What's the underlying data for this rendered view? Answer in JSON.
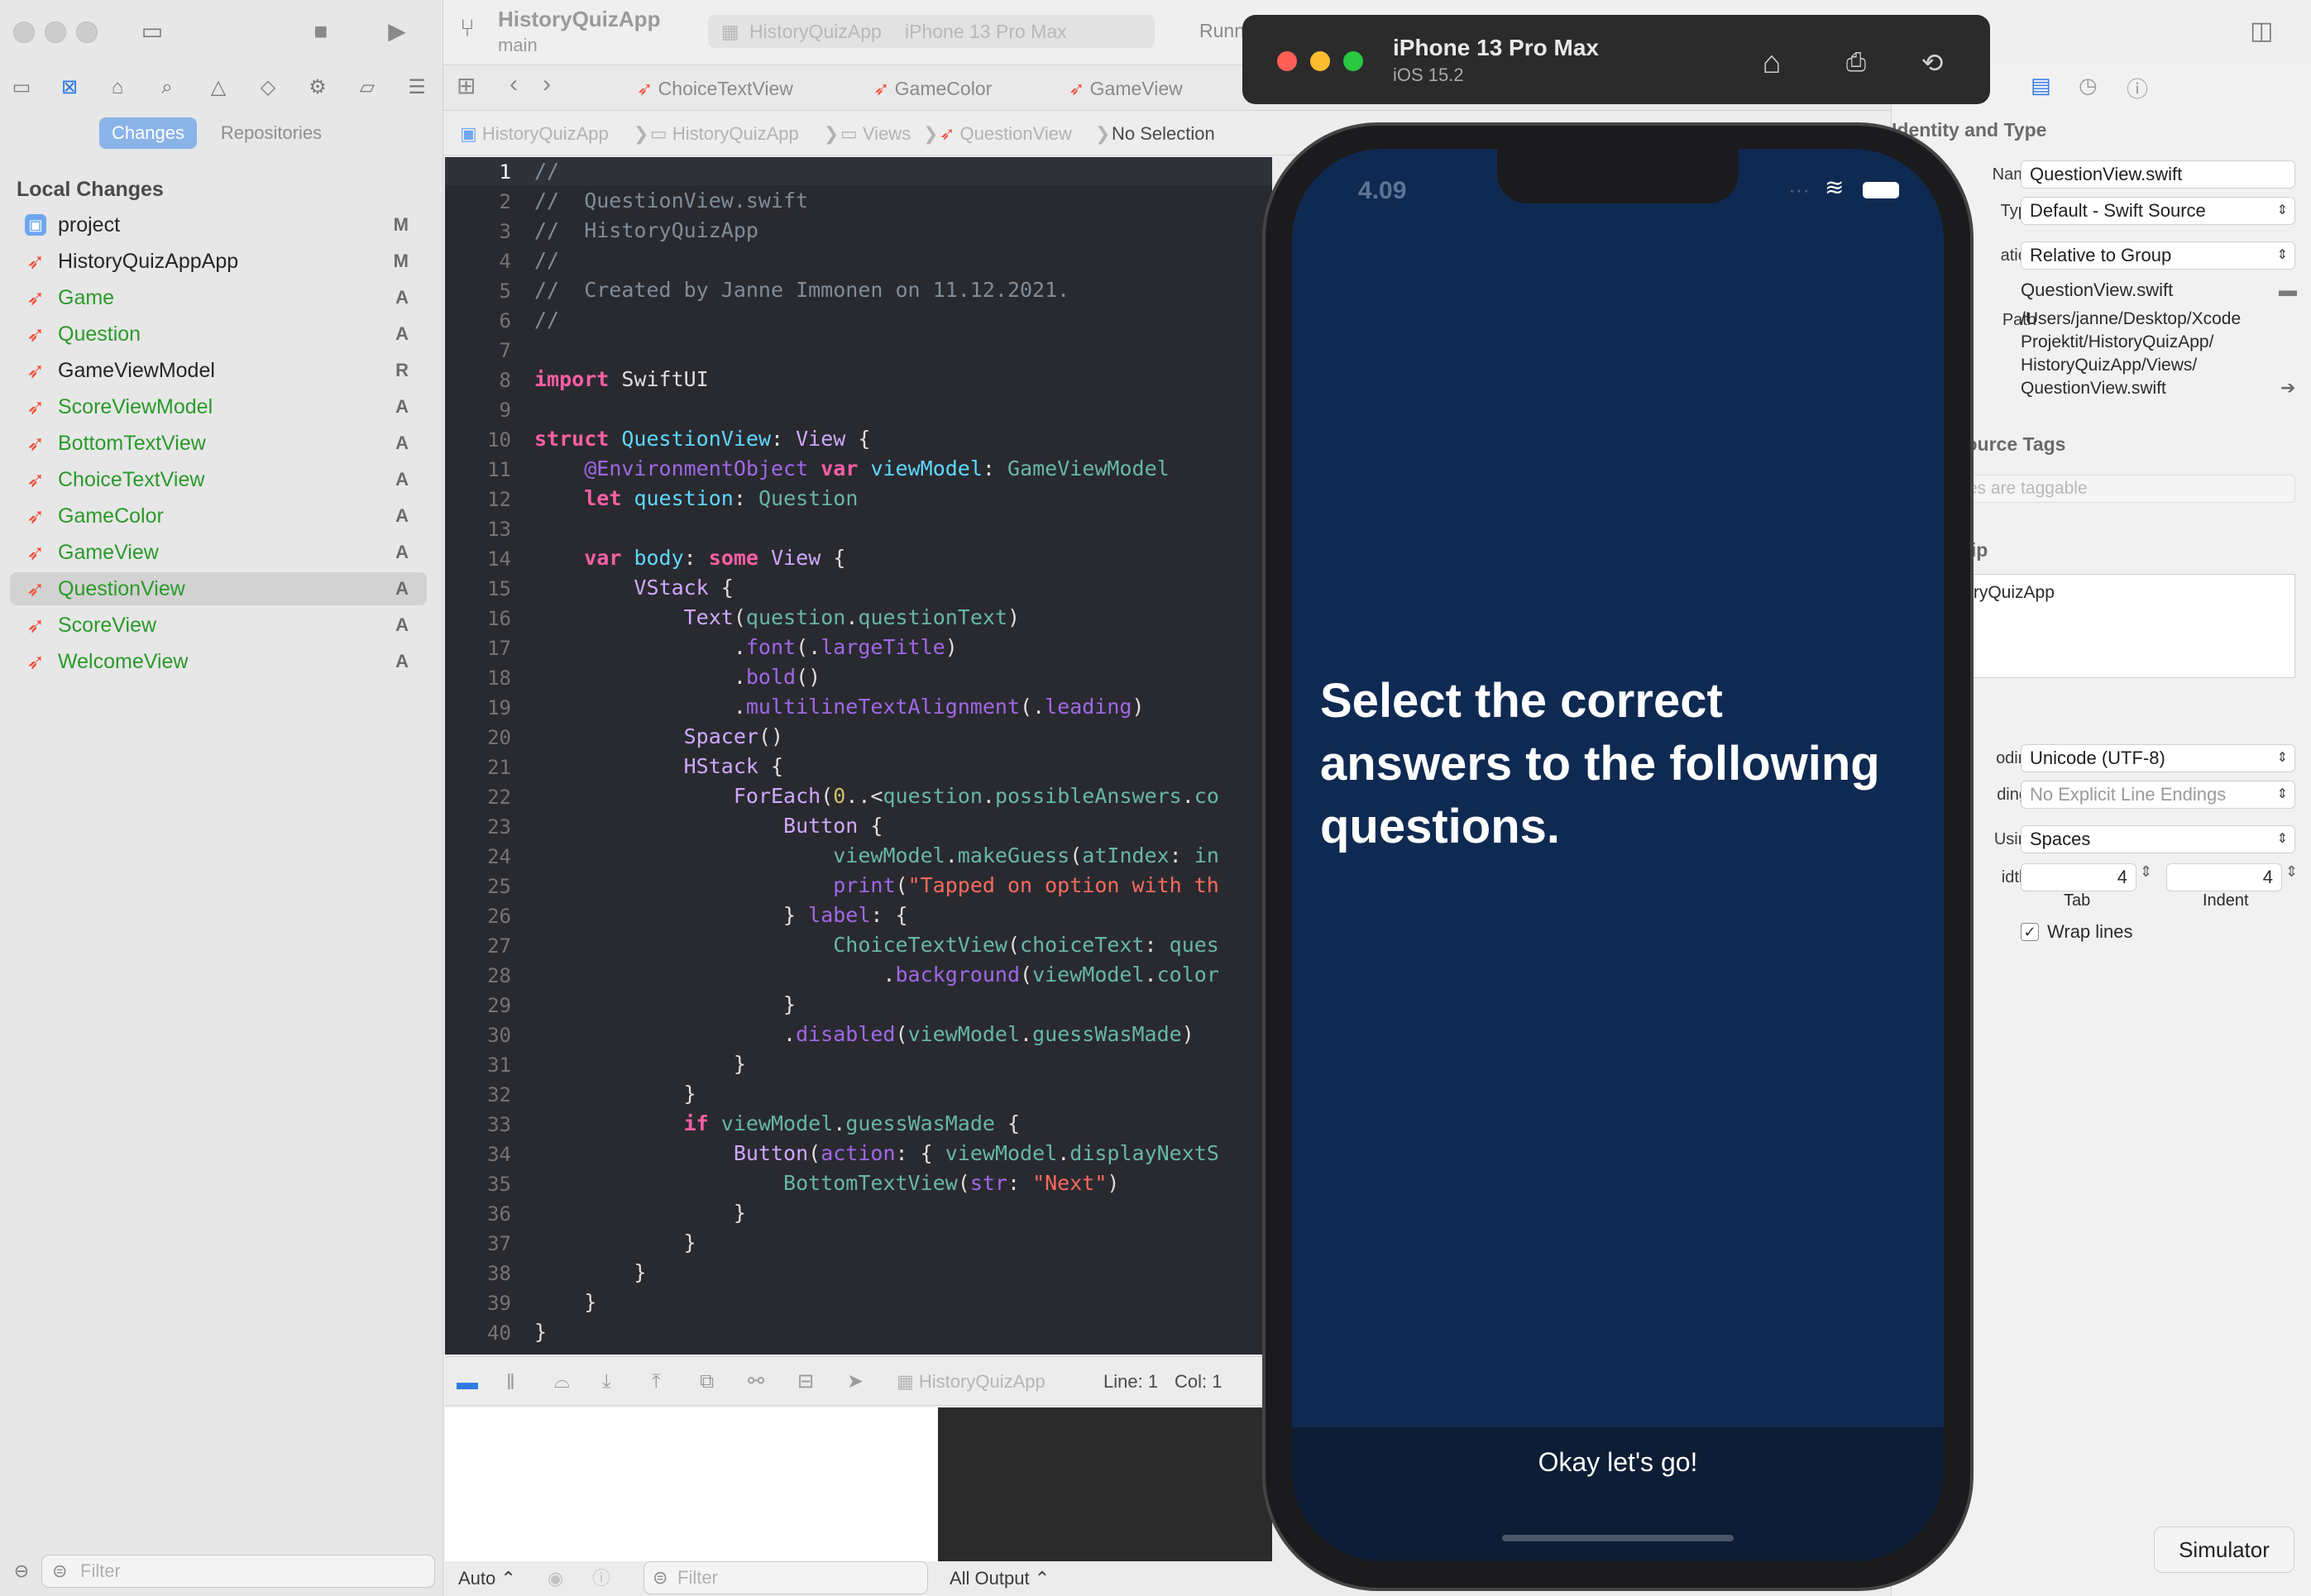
{
  "toolbar": {
    "project_name": "HistoryQuizApp",
    "branch": "main",
    "scheme": "HistoryQuizApp",
    "destination": "iPhone 13 Pro Max",
    "status": "Runn"
  },
  "navigator": {
    "segments": [
      "Changes",
      "Repositories"
    ],
    "section_title": "Local Changes",
    "files": [
      {
        "name": "project",
        "status": "M"
      },
      {
        "name": "HistoryQuizAppApp",
        "status": "M"
      },
      {
        "name": "Game",
        "status": "A"
      },
      {
        "name": "Question",
        "status": "A"
      },
      {
        "name": "GameViewModel",
        "status": "R"
      },
      {
        "name": "ScoreViewModel",
        "status": "A"
      },
      {
        "name": "BottomTextView",
        "status": "A"
      },
      {
        "name": "ChoiceTextView",
        "status": "A"
      },
      {
        "name": "GameColor",
        "status": "A"
      },
      {
        "name": "GameView",
        "status": "A"
      },
      {
        "name": "QuestionView",
        "status": "A"
      },
      {
        "name": "ScoreView",
        "status": "A"
      },
      {
        "name": "WelcomeView",
        "status": "A"
      }
    ],
    "filter_placeholder": "Filter"
  },
  "tabs": [
    "ChoiceTextView",
    "GameColor",
    "GameView"
  ],
  "jumpbar": [
    "HistoryQuizApp",
    "HistoryQuizApp",
    "Views",
    "QuestionView",
    "No Selection"
  ],
  "editor": {
    "line_numbers": [
      "1",
      "2",
      "3",
      "4",
      "5",
      "6",
      "7",
      "8",
      "9",
      "10",
      "11",
      "12",
      "13",
      "14",
      "15",
      "16",
      "17",
      "18",
      "19",
      "20",
      "21",
      "22",
      "23",
      "24",
      "25",
      "26",
      "27",
      "28",
      "29",
      "30",
      "31",
      "32",
      "33",
      "34",
      "35",
      "36",
      "37",
      "38",
      "39",
      "40"
    ]
  },
  "debugbar": {
    "scheme": "HistoryQuizApp",
    "line_label": "Line: 1",
    "col_label": "Col: 1"
  },
  "bottombar": {
    "auto": "Auto",
    "filter": "Filter",
    "output": "All Output"
  },
  "inspector": {
    "identity_title": "Identity and Type",
    "name_label": "Name",
    "name_value": "QuestionView.swift",
    "type_label": "Type",
    "type_value": "Default - Swift Source",
    "location_label": "ation",
    "location_value": "Relative to Group",
    "file_name": "QuestionView.swift",
    "path_label": "Path",
    "path_value": "/Users/janne/Desktop/Xcode Projektit/HistoryQuizApp/ HistoryQuizApp/Views/ QuestionView.swift",
    "tags_title": "and Resource Tags",
    "tags_placeholder": "ources are taggable",
    "membership_title": "embership",
    "membership_target": "HistoryQuizApp",
    "settings_title": "tings",
    "encoding_label": "oding",
    "encoding_value": "Unicode (UTF-8)",
    "endings_label": "dings",
    "endings_value": "No Explicit Line Endings",
    "using_label": "Using",
    "using_value": "Spaces",
    "widths_label": "idths",
    "tab_value": "4",
    "indent_value": "4",
    "tab_caption": "Tab",
    "indent_caption": "Indent",
    "wrap_label": "Wrap lines"
  },
  "simulator": {
    "device": "iPhone 13 Pro Max",
    "os": "iOS 15.2",
    "time": "4.09",
    "headline": "Select the correct answers to the following questions.",
    "button": "Okay let's go!",
    "tooltip": "Simulator"
  },
  "colors": {
    "screen_bg": "#0f2a52",
    "editor_bg": "#292a30",
    "added_file": "#2a9a2a"
  }
}
